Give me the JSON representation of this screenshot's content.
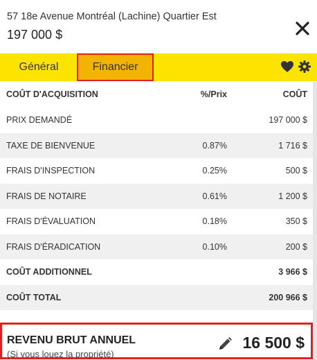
{
  "header": {
    "address": "57 18e Avenue Montréal (Lachine) Quartier Est",
    "price": "197 000 $"
  },
  "tabs": [
    {
      "label": "Général",
      "active": false
    },
    {
      "label": "Financier",
      "active": true
    }
  ],
  "icons": {
    "favorite": "heart-icon",
    "settings": "gear-icon",
    "close": "close-icon",
    "edit": "pencil-icon"
  },
  "table": {
    "headers": {
      "label": "COÛT D'ACQUISITION",
      "pct": "%/Prix",
      "cost": "COÛT"
    },
    "rows": [
      {
        "label": "PRIX DEMANDÉ",
        "pct": "",
        "cost": "197 000 $"
      },
      {
        "label": "TAXE DE BIENVENUE",
        "pct": "0.87%",
        "cost": "1 716 $"
      },
      {
        "label": "FRAIS D'INSPECTION",
        "pct": "0.25%",
        "cost": "500 $"
      },
      {
        "label": "FRAIS DE NOTAIRE",
        "pct": "0.61%",
        "cost": "1 200 $"
      },
      {
        "label": "FRAIS D'ÉVALUATION",
        "pct": "0.18%",
        "cost": "350 $"
      },
      {
        "label": "FRAIS D'ÉRADICATION",
        "pct": "0.10%",
        "cost": "200 $"
      }
    ],
    "additional": {
      "label": "COÛT ADDITIONNEL",
      "cost": "3 966 $"
    },
    "total": {
      "label": "COÛT TOTAL",
      "cost": "200 966 $"
    }
  },
  "revenue": {
    "title": "REVENU BRUT ANNUEL",
    "subtitle": "(Si vous louez la propriété)",
    "value": "16 500 $"
  },
  "colors": {
    "tab_bar": "#fde300",
    "active_tab": "#f2b400",
    "highlight_border": "#e3201d",
    "row_alt": "#f0f0f0"
  }
}
